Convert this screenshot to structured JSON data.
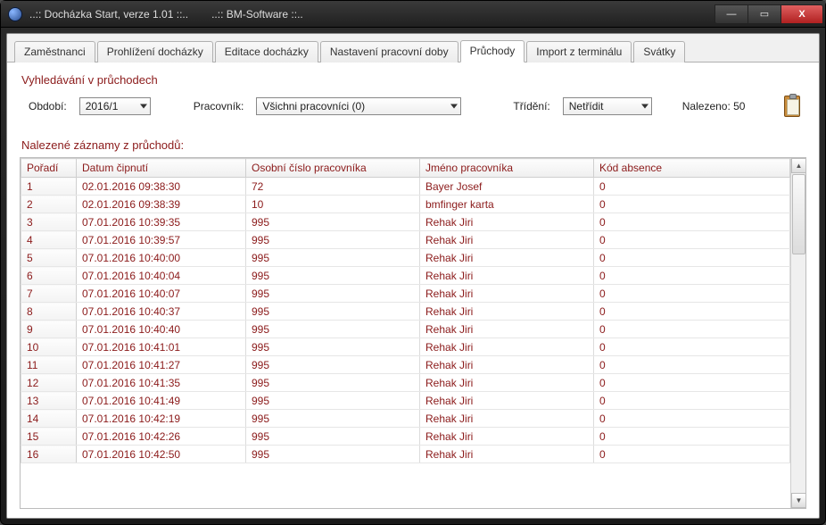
{
  "window": {
    "title_a": "..:: Docházka Start, verze 1.01 ::..",
    "title_b": "..:: BM-Software ::.."
  },
  "tabs": [
    {
      "label": "Zaměstnanci",
      "active": false
    },
    {
      "label": "Prohlížení docházky",
      "active": false
    },
    {
      "label": "Editace docházky",
      "active": false
    },
    {
      "label": "Nastavení pracovní doby",
      "active": false
    },
    {
      "label": "Průchody",
      "active": true
    },
    {
      "label": "Import z terminálu",
      "active": false
    },
    {
      "label": "Svátky",
      "active": false
    }
  ],
  "search": {
    "title": "Vyhledávání v průchodech",
    "period_label": "Období:",
    "period_value": "2016/1",
    "worker_label": "Pracovník:",
    "worker_value": "Všichni pracovníci (0)",
    "sort_label": "Třídění:",
    "sort_value": "Netřídit",
    "found_label": "Nalezeno: 50"
  },
  "records": {
    "title": "Nalezené záznamy z průchodů:",
    "columns": {
      "order": "Pořadí",
      "datetime": "Datum čipnutí",
      "emp_no": "Osobní číslo pracovníka",
      "emp_name": "Jméno pracovníka",
      "abs_code": "Kód absence"
    },
    "rows": [
      {
        "order": "1",
        "dt": "02.01.2016 09:38:30",
        "no": "72",
        "name": "Bayer Josef",
        "code": "0"
      },
      {
        "order": "2",
        "dt": "02.01.2016 09:38:39",
        "no": "10",
        "name": "bmfinger karta",
        "code": "0"
      },
      {
        "order": "3",
        "dt": "07.01.2016 10:39:35",
        "no": "995",
        "name": "Rehak Jiri",
        "code": "0"
      },
      {
        "order": "4",
        "dt": "07.01.2016 10:39:57",
        "no": "995",
        "name": "Rehak Jiri",
        "code": "0"
      },
      {
        "order": "5",
        "dt": "07.01.2016 10:40:00",
        "no": "995",
        "name": "Rehak Jiri",
        "code": "0"
      },
      {
        "order": "6",
        "dt": "07.01.2016 10:40:04",
        "no": "995",
        "name": "Rehak Jiri",
        "code": "0"
      },
      {
        "order": "7",
        "dt": "07.01.2016 10:40:07",
        "no": "995",
        "name": "Rehak Jiri",
        "code": "0"
      },
      {
        "order": "8",
        "dt": "07.01.2016 10:40:37",
        "no": "995",
        "name": "Rehak Jiri",
        "code": "0"
      },
      {
        "order": "9",
        "dt": "07.01.2016 10:40:40",
        "no": "995",
        "name": "Rehak Jiri",
        "code": "0"
      },
      {
        "order": "10",
        "dt": "07.01.2016 10:41:01",
        "no": "995",
        "name": "Rehak Jiri",
        "code": "0"
      },
      {
        "order": "11",
        "dt": "07.01.2016 10:41:27",
        "no": "995",
        "name": "Rehak Jiri",
        "code": "0"
      },
      {
        "order": "12",
        "dt": "07.01.2016 10:41:35",
        "no": "995",
        "name": "Rehak Jiri",
        "code": "0"
      },
      {
        "order": "13",
        "dt": "07.01.2016 10:41:49",
        "no": "995",
        "name": "Rehak Jiri",
        "code": "0"
      },
      {
        "order": "14",
        "dt": "07.01.2016 10:42:19",
        "no": "995",
        "name": "Rehak Jiri",
        "code": "0"
      },
      {
        "order": "15",
        "dt": "07.01.2016 10:42:26",
        "no": "995",
        "name": "Rehak Jiri",
        "code": "0"
      },
      {
        "order": "16",
        "dt": "07.01.2016 10:42:50",
        "no": "995",
        "name": "Rehak Jiri",
        "code": "0"
      }
    ]
  }
}
